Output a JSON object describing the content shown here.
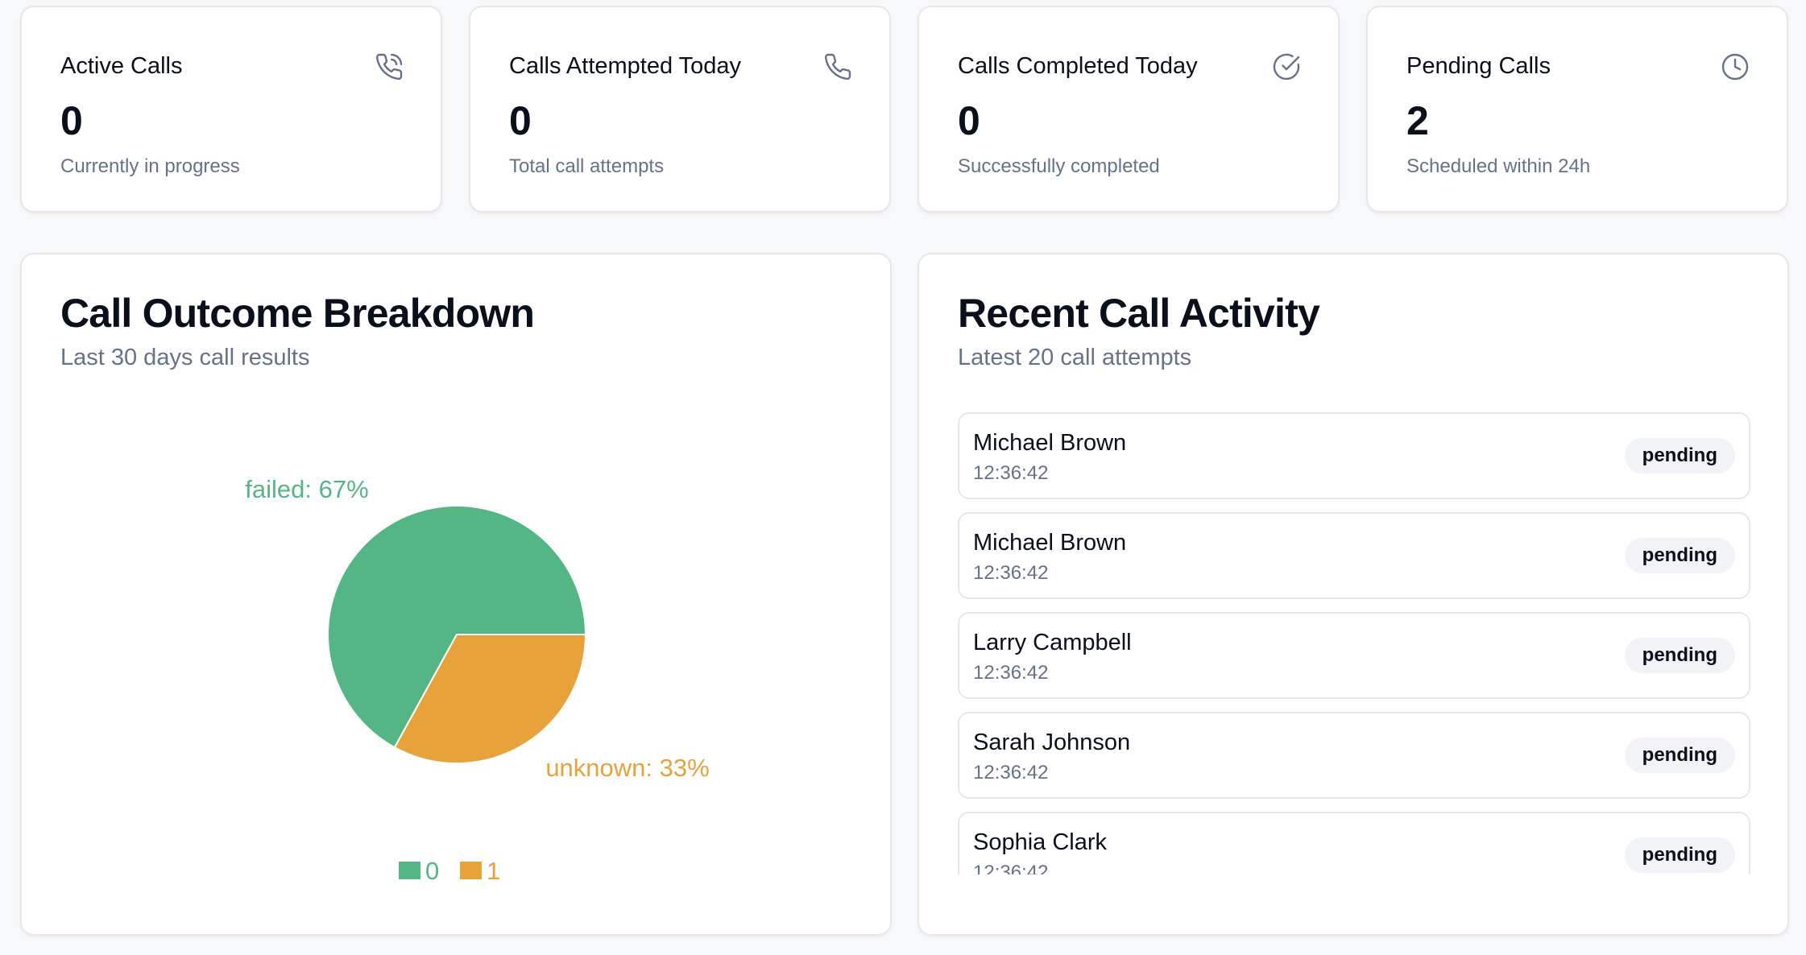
{
  "stats": [
    {
      "title": "Active Calls",
      "value": "0",
      "sub": "Currently in progress",
      "icon": "phone-call-icon"
    },
    {
      "title": "Calls Attempted Today",
      "value": "0",
      "sub": "Total call attempts",
      "icon": "phone-icon"
    },
    {
      "title": "Calls Completed Today",
      "value": "0",
      "sub": "Successfully completed",
      "icon": "check-circle-icon"
    },
    {
      "title": "Pending Calls",
      "value": "2",
      "sub": "Scheduled within 24h",
      "icon": "clock-icon"
    }
  ],
  "outcome": {
    "title": "Call Outcome Breakdown",
    "subtitle": "Last 30 days call results"
  },
  "activity": {
    "title": "Recent Call Activity",
    "subtitle": "Latest 20 call attempts",
    "items": [
      {
        "name": "Michael Brown",
        "time": "12:36:42",
        "status": "pending"
      },
      {
        "name": "Michael Brown",
        "time": "12:36:42",
        "status": "pending"
      },
      {
        "name": "Larry Campbell",
        "time": "12:36:42",
        "status": "pending"
      },
      {
        "name": "Sarah Johnson",
        "time": "12:36:42",
        "status": "pending"
      },
      {
        "name": "Sophia Clark",
        "time": "12:36:42",
        "status": "pending"
      }
    ]
  },
  "chart_data": {
    "type": "pie",
    "categories": [
      "failed",
      "unknown"
    ],
    "values": [
      67,
      33
    ],
    "slice_labels": [
      "failed: 67%",
      "unknown: 33%"
    ],
    "legend": [
      "0",
      "1"
    ],
    "legend_placement": "bottom",
    "colors": [
      "#54b685",
      "#e8a23b"
    ]
  }
}
